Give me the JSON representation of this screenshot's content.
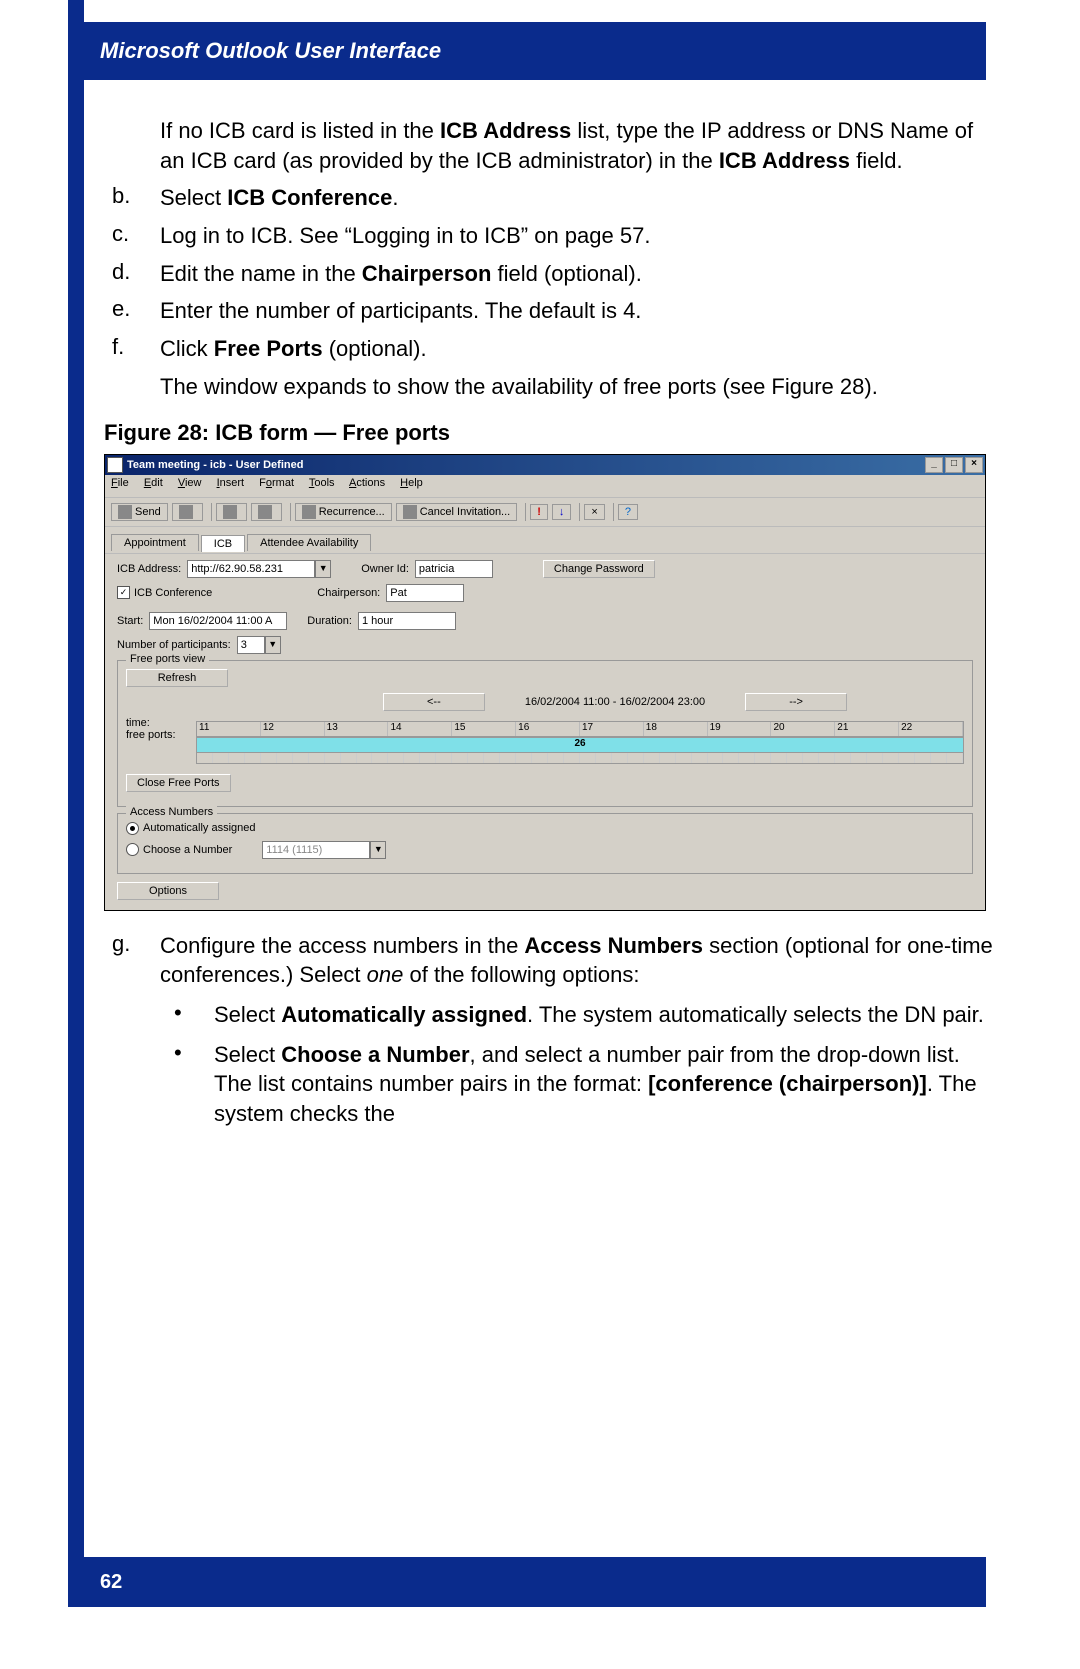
{
  "header": {
    "title": "Microsoft Outlook User Interface"
  },
  "intro": "If no ICB card is listed in the <b>ICB Address</b> list, type the IP address or DNS Name of an ICB card (as provided by the ICB administrator) in the <b>ICB Address</b> field.",
  "steps": {
    "b": "Select <b>ICB Conference</b>.",
    "c": "Log in to ICB. See “Logging in to ICB” on page 57.",
    "d": "Edit the name in the <b>Chairperson</b> field (optional).",
    "e": "Enter the number of participants. The default is 4.",
    "f": "Click <b>Free Ports</b> (optional).",
    "f_cont": "The window expands to show the availability of free ports (see Figure 28)."
  },
  "figure": {
    "title": "Figure 28: ICB form — Free ports"
  },
  "window": {
    "title": "Team meeting - icb  - User Defined",
    "menu": [
      "File",
      "Edit",
      "View",
      "Insert",
      "Format",
      "Tools",
      "Actions",
      "Help"
    ],
    "toolbar": {
      "send": "Send",
      "recurrence": "Recurrence...",
      "cancel": "Cancel Invitation..."
    },
    "tabs": {
      "appointment": "Appointment",
      "icb": "ICB",
      "attendee": "Attendee Availability"
    },
    "form": {
      "icb_address_label": "ICB Address:",
      "icb_address": "http://62.90.58.231",
      "owner_label": "Owner Id:",
      "owner": "patricia",
      "change_pw": "Change Password",
      "icb_conf_label": "ICB Conference",
      "chair_label": "Chairperson:",
      "chair": "Pat",
      "start_label": "Start:",
      "start": "Mon 16/02/2004 11:00 A",
      "duration_label": "Duration:",
      "duration": "1 hour",
      "participants_label": "Number of participants:",
      "participants": "3"
    },
    "freeports": {
      "title": "Free ports view",
      "refresh": "Refresh",
      "prev": "<--",
      "range": "16/02/2004 11:00 - 16/02/2004 23:00",
      "next": "-->",
      "time_label": "time:",
      "ports_label": "free ports:",
      "hours": [
        "11",
        "12",
        "13",
        "14",
        "15",
        "16",
        "17",
        "18",
        "19",
        "20",
        "21",
        "22"
      ],
      "ports_value": "26",
      "close": "Close Free Ports"
    },
    "access": {
      "title": "Access Numbers",
      "auto": "Automatically assigned",
      "choose": "Choose a Number",
      "choose_val": "1114 (1115)"
    },
    "options": "Options"
  },
  "steps2": {
    "g": "Configure the access numbers in the <b>Access Numbers</b> section (optional for one-time conferences.) Select <i>one</i> of the following options:",
    "bullet1": "Select <b>Automatically assigned</b>. The system automatically selects the DN pair.",
    "bullet2": "Select <b>Choose a Number</b>, and select a number pair from the drop-down list. The list contains number pairs in the format: <b>[conference (chairperson)]</b>. The system checks the"
  },
  "footer": {
    "page": "62"
  }
}
